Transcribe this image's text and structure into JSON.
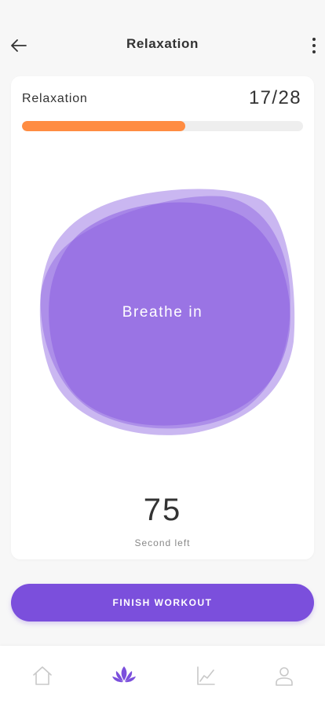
{
  "header": {
    "title": "Relaxation",
    "back_icon": "arrow-left-icon",
    "more_icon": "more-vertical-icon"
  },
  "exercise": {
    "label": "Relaxation",
    "count": "17/28",
    "progress_fraction": 0.58,
    "progress_color": "#ff8c42",
    "track_color": "#eeeeee"
  },
  "breath": {
    "instruction": "Breathe in",
    "blob_color": "#8a5fe0"
  },
  "timer": {
    "value": "75",
    "caption": "Second left"
  },
  "actions": {
    "finish_label": "FINISH WORKOUT",
    "finish_color": "#7b4fdc"
  },
  "bottom_nav": {
    "items": [
      {
        "icon": "home-icon",
        "active": false
      },
      {
        "icon": "lotus-icon",
        "active": true
      },
      {
        "icon": "chart-icon",
        "active": false
      },
      {
        "icon": "profile-icon",
        "active": false
      }
    ],
    "active_color": "#7b4fdc",
    "inactive_color": "#c8c8c8"
  }
}
